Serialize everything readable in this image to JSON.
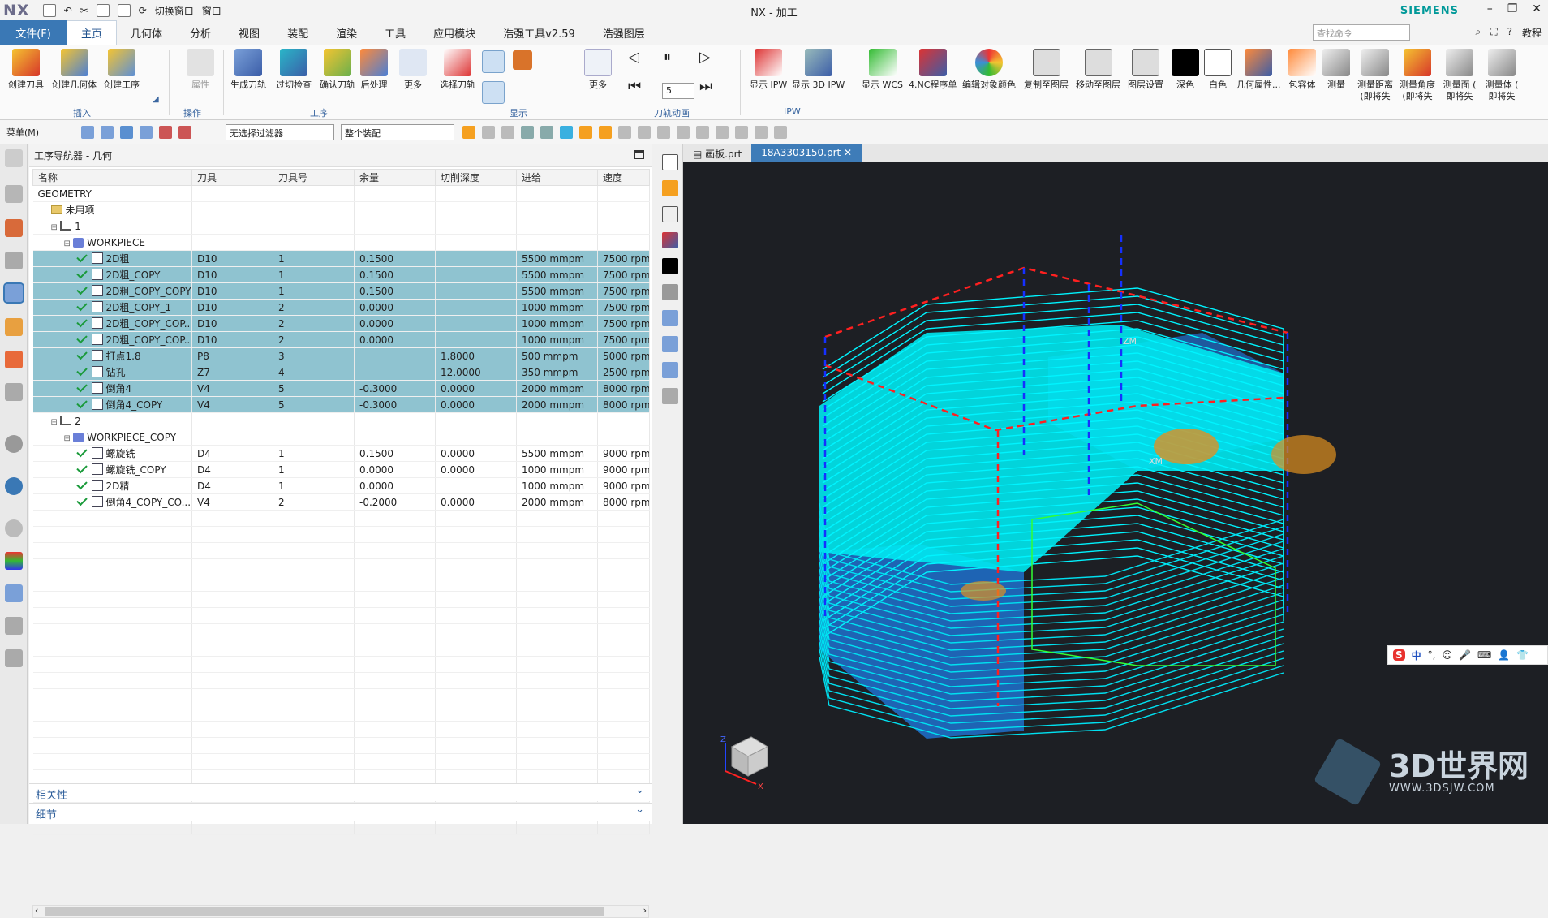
{
  "app": {
    "logo": "NX",
    "title": "NX - 加工",
    "brand": "SIEMENS",
    "quick_switch": "切换窗口",
    "quick_window": "窗口"
  },
  "menu": {
    "file": "文件(F)",
    "tabs": [
      "主页",
      "几何体",
      "分析",
      "视图",
      "装配",
      "渲染",
      "工具",
      "应用模块",
      "浩强工具v2.59",
      "浩强图层"
    ],
    "search_placeholder": "查找命令",
    "help": "教程"
  },
  "ribbon": {
    "buttons": [
      {
        "label": "创建刀具",
        "icon": "create-tool-icon"
      },
      {
        "label": "创建几何体",
        "icon": "create-geometry-icon"
      },
      {
        "label": "创建工序",
        "icon": "create-operation-icon"
      },
      {
        "label": "属性",
        "icon": "properties-icon"
      },
      {
        "label": "生成刀轨",
        "icon": "generate-path-icon"
      },
      {
        "label": "过切检查",
        "icon": "gouge-check-icon"
      },
      {
        "label": "确认刀轨",
        "icon": "verify-path-icon"
      },
      {
        "label": "后处理",
        "icon": "postprocess-icon"
      },
      {
        "label": "更多",
        "icon": "more-icon"
      },
      {
        "label": "选择刀轨",
        "icon": "select-path-icon"
      },
      {
        "label": "更多",
        "icon": "more-icon"
      },
      {
        "label": "显示 IPW",
        "icon": "show-ipw-icon"
      },
      {
        "label": "显示 3D IPW",
        "icon": "show-3d-ipw-icon"
      },
      {
        "label": "显示 WCS",
        "icon": "show-wcs-icon"
      },
      {
        "label": "4.NC程序单",
        "icon": "nc-program-icon"
      },
      {
        "label": "编辑对象颜色",
        "icon": "edit-color-icon"
      },
      {
        "label": "复制至图层",
        "icon": "copy-layer-icon"
      },
      {
        "label": "移动至图层",
        "icon": "move-layer-icon"
      },
      {
        "label": "图层设置",
        "icon": "layer-settings-icon"
      },
      {
        "label": "深色",
        "icon": "dark-icon"
      },
      {
        "label": "白色",
        "icon": "white-icon"
      },
      {
        "label": "几何属性...",
        "icon": "geom-props-icon"
      },
      {
        "label": "包容体",
        "icon": "bounding-body-icon"
      },
      {
        "label": "测量",
        "icon": "measure-icon"
      },
      {
        "label": "测量距离 (即将失",
        "icon": "measure-distance-icon"
      },
      {
        "label": "测量角度 (即将失",
        "icon": "measure-angle-icon"
      },
      {
        "label": "测量面 ( 即将失",
        "icon": "measure-face-icon"
      },
      {
        "label": "测量体 ( 即将失",
        "icon": "measure-body-icon"
      }
    ],
    "groups": [
      "插入",
      "操作",
      "工序",
      "显示",
      "刀轨动画",
      "IPW"
    ],
    "anim_speed": "5"
  },
  "toolbar2": {
    "menu": "菜单(M)",
    "filter": "无选择过滤器",
    "assembly": "整个装配"
  },
  "navigator": {
    "title": "工序导航器 - 几何",
    "columns": [
      "名称",
      "刀具",
      "刀具号",
      "余量",
      "切削深度",
      "进给",
      "速度"
    ],
    "rows": [
      {
        "indent": 0,
        "type": "root",
        "name": "GEOMETRY",
        "tool": "",
        "no": "",
        "stock": "",
        "depth": "",
        "feed": "",
        "speed": "",
        "sel": false
      },
      {
        "indent": 1,
        "type": "folder",
        "name": "未用项",
        "tool": "",
        "no": "",
        "stock": "",
        "depth": "",
        "feed": "",
        "speed": "",
        "sel": false
      },
      {
        "indent": 1,
        "type": "mcs",
        "name": "1",
        "tool": "",
        "no": "",
        "stock": "",
        "depth": "",
        "feed": "",
        "speed": "",
        "sel": false
      },
      {
        "indent": 2,
        "type": "group",
        "name": "WORKPIECE",
        "tool": "",
        "no": "",
        "stock": "",
        "depth": "",
        "feed": "",
        "speed": "",
        "sel": false
      },
      {
        "indent": 3,
        "type": "op",
        "name": "2D粗",
        "tool": "D10",
        "no": "1",
        "stock": "0.1500",
        "depth": "",
        "feed": "5500 mmpm",
        "speed": "7500 rpm",
        "sel": true
      },
      {
        "indent": 3,
        "type": "op",
        "name": "2D粗_COPY",
        "tool": "D10",
        "no": "1",
        "stock": "0.1500",
        "depth": "",
        "feed": "5500 mmpm",
        "speed": "7500 rpm",
        "sel": true
      },
      {
        "indent": 3,
        "type": "op",
        "name": "2D粗_COPY_COPY",
        "tool": "D10",
        "no": "1",
        "stock": "0.1500",
        "depth": "",
        "feed": "5500 mmpm",
        "speed": "7500 rpm",
        "sel": true
      },
      {
        "indent": 3,
        "type": "op",
        "name": "2D粗_COPY_1",
        "tool": "D10",
        "no": "2",
        "stock": "0.0000",
        "depth": "",
        "feed": "1000 mmpm",
        "speed": "7500 rpm",
        "sel": true
      },
      {
        "indent": 3,
        "type": "op",
        "name": "2D粗_COPY_COP...",
        "tool": "D10",
        "no": "2",
        "stock": "0.0000",
        "depth": "",
        "feed": "1000 mmpm",
        "speed": "7500 rpm",
        "sel": true
      },
      {
        "indent": 3,
        "type": "op",
        "name": "2D粗_COPY_COP...",
        "tool": "D10",
        "no": "2",
        "stock": "0.0000",
        "depth": "",
        "feed": "1000 mmpm",
        "speed": "7500 rpm",
        "sel": true
      },
      {
        "indent": 3,
        "type": "op",
        "name": "打点1.8",
        "tool": "P8",
        "no": "3",
        "stock": "",
        "depth": "1.8000",
        "feed": "500 mmpm",
        "speed": "5000 rpm",
        "sel": true
      },
      {
        "indent": 3,
        "type": "op",
        "name": "钻孔",
        "tool": "Z7",
        "no": "4",
        "stock": "",
        "depth": "12.0000",
        "feed": "350 mmpm",
        "speed": "2500 rpm",
        "sel": true
      },
      {
        "indent": 3,
        "type": "op",
        "name": "倒角4",
        "tool": "V4",
        "no": "5",
        "stock": "-0.3000",
        "depth": "0.0000",
        "feed": "2000 mmpm",
        "speed": "8000 rpm",
        "sel": true
      },
      {
        "indent": 3,
        "type": "op",
        "name": "倒角4_COPY",
        "tool": "V4",
        "no": "5",
        "stock": "-0.3000",
        "depth": "0.0000",
        "feed": "2000 mmpm",
        "speed": "8000 rpm",
        "sel": true
      },
      {
        "indent": 1,
        "type": "mcs",
        "name": "2",
        "tool": "",
        "no": "",
        "stock": "",
        "depth": "",
        "feed": "",
        "speed": "",
        "sel": false
      },
      {
        "indent": 2,
        "type": "group",
        "name": "WORKPIECE_COPY",
        "tool": "",
        "no": "",
        "stock": "",
        "depth": "",
        "feed": "",
        "speed": "",
        "sel": false
      },
      {
        "indent": 3,
        "type": "op",
        "name": "螺旋铣",
        "tool": "D4",
        "no": "1",
        "stock": "0.1500",
        "depth": "0.0000",
        "feed": "5500 mmpm",
        "speed": "9000 rpm",
        "sel": false
      },
      {
        "indent": 3,
        "type": "op",
        "name": "螺旋铣_COPY",
        "tool": "D4",
        "no": "1",
        "stock": "0.0000",
        "depth": "0.0000",
        "feed": "1000 mmpm",
        "speed": "9000 rpm",
        "sel": false
      },
      {
        "indent": 3,
        "type": "op",
        "name": "2D精",
        "tool": "D4",
        "no": "1",
        "stock": "0.0000",
        "depth": "",
        "feed": "1000 mmpm",
        "speed": "9000 rpm",
        "sel": false
      },
      {
        "indent": 3,
        "type": "op",
        "name": "倒角4_COPY_CO...",
        "tool": "V4",
        "no": "2",
        "stock": "-0.2000",
        "depth": "0.0000",
        "feed": "2000 mmpm",
        "speed": "8000 rpm",
        "sel": false
      }
    ],
    "panels": [
      "相关性",
      "细节"
    ]
  },
  "viewport": {
    "tabs": [
      "画板.prt",
      "18A3303150.prt"
    ],
    "axis_labels": [
      "ZM",
      "XM",
      "Z",
      "X"
    ]
  },
  "ime": {
    "logo": "S",
    "mode": "中"
  },
  "watermark": {
    "title": "3D世界网",
    "url": "WWW.3DSJW.COM"
  }
}
